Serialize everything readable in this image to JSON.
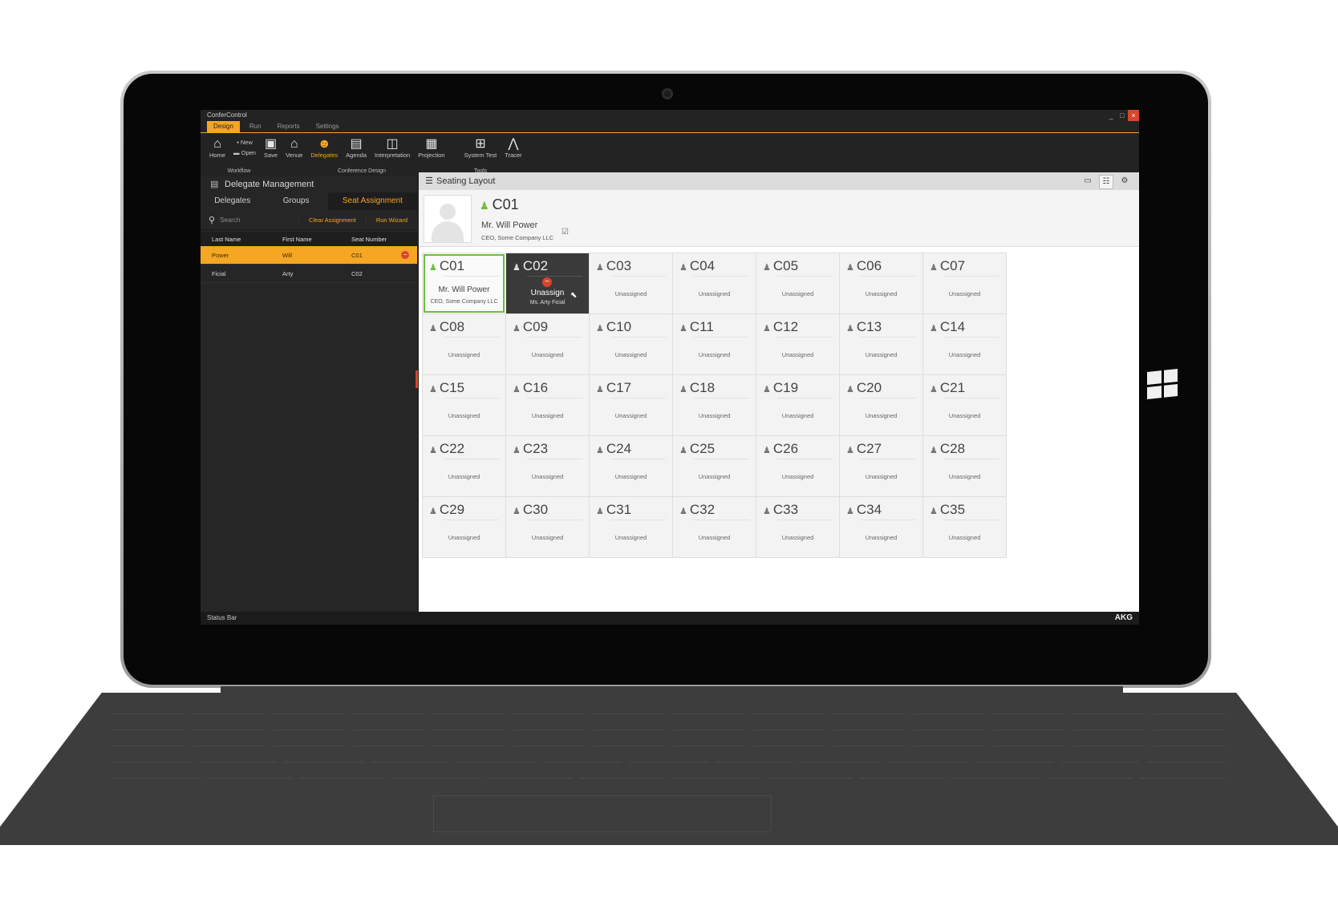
{
  "app": {
    "title": "ConferControl",
    "window_controls": [
      "_",
      "□",
      "×"
    ],
    "menu_tabs": [
      "Design",
      "Run",
      "Reports",
      "Settings"
    ]
  },
  "ribbon": {
    "buttons": [
      {
        "label": "Home",
        "icon": "home-icon",
        "glyph": "⌂"
      },
      {
        "label": "New",
        "icon": "new-icon",
        "glyph": "▪"
      },
      {
        "label": "Open",
        "icon": "open-icon",
        "glyph": "▬"
      },
      {
        "label": "Save",
        "icon": "save-icon",
        "glyph": "▣"
      },
      {
        "label": "Venue",
        "icon": "venue-icon",
        "glyph": "⌂"
      },
      {
        "label": "Delegates",
        "icon": "delegates-icon",
        "glyph": "☻"
      },
      {
        "label": "Agenda",
        "icon": "agenda-icon",
        "glyph": "▤"
      },
      {
        "label": "Interpretation",
        "icon": "interpretation-icon",
        "glyph": "◫"
      },
      {
        "label": "Projection",
        "icon": "projection-icon",
        "glyph": "▦"
      },
      {
        "label": "System Test",
        "icon": "system-test-icon",
        "glyph": "⊞"
      },
      {
        "label": "Tracer",
        "icon": "tracer-icon",
        "glyph": "⋀"
      }
    ],
    "groups": [
      "Workflow",
      "Conference Design",
      "Tools"
    ]
  },
  "left_panel": {
    "title": "Delegate Management",
    "tabs": [
      "Delegates",
      "Groups",
      "Seat Assignment"
    ],
    "search_placeholder": "Search",
    "clear_assignment": "Clear Assignment",
    "run_wizard": "Run Wizard",
    "columns": [
      "Last Name",
      "First Name",
      "Seat Number"
    ],
    "rows": [
      {
        "last": "Power",
        "first": "Will",
        "seat": "C01",
        "selected": true
      },
      {
        "last": "Ficial",
        "first": "Arty",
        "seat": "C02",
        "selected": false
      }
    ]
  },
  "seating": {
    "title": "Seating Layout",
    "detail": {
      "seat": "C01",
      "name": "Mr. Will Power",
      "company": "CEO, Some Company LLC"
    },
    "unassigned_label": "Unassigned",
    "seats": [
      {
        "id": "C01",
        "state": "assigned",
        "name": "Mr. Will Power",
        "company": "CEO, Some Company LLC"
      },
      {
        "id": "C02",
        "state": "hover",
        "action": "Unassign",
        "name": "Ms. Arty Ficial"
      },
      {
        "id": "C03"
      },
      {
        "id": "C04"
      },
      {
        "id": "C05"
      },
      {
        "id": "C06"
      },
      {
        "id": "C07"
      },
      {
        "id": "C08"
      },
      {
        "id": "C09"
      },
      {
        "id": "C10"
      },
      {
        "id": "C11"
      },
      {
        "id": "C12"
      },
      {
        "id": "C13"
      },
      {
        "id": "C14"
      },
      {
        "id": "C15"
      },
      {
        "id": "C16"
      },
      {
        "id": "C17"
      },
      {
        "id": "C18"
      },
      {
        "id": "C19"
      },
      {
        "id": "C20"
      },
      {
        "id": "C21"
      },
      {
        "id": "C22"
      },
      {
        "id": "C23"
      },
      {
        "id": "C24"
      },
      {
        "id": "C25"
      },
      {
        "id": "C26"
      },
      {
        "id": "C27"
      },
      {
        "id": "C28"
      },
      {
        "id": "C29"
      },
      {
        "id": "C30"
      },
      {
        "id": "C31"
      },
      {
        "id": "C32"
      },
      {
        "id": "C33"
      },
      {
        "id": "C34"
      },
      {
        "id": "C35"
      }
    ]
  },
  "status_bar": {
    "text": "Status Bar",
    "brand": "AKG"
  },
  "colors": {
    "accent": "#f5a623",
    "assigned": "#6cbf3c",
    "danger": "#d9452c"
  }
}
